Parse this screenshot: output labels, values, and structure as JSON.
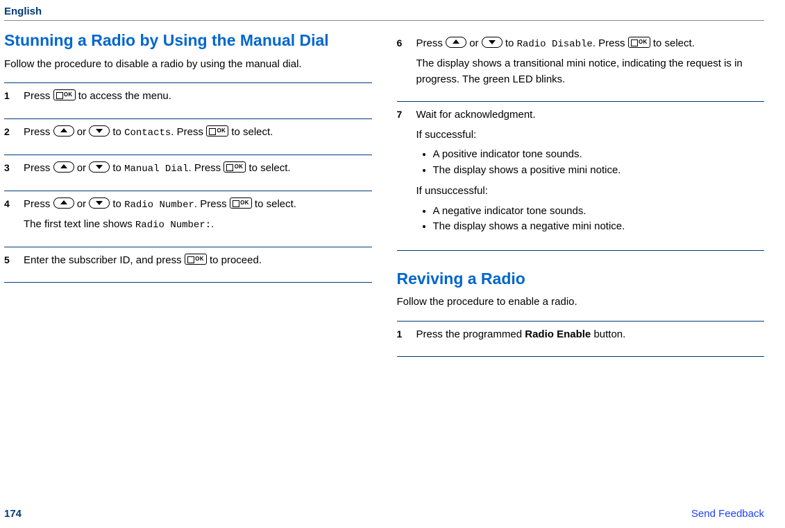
{
  "header": {
    "language": "English"
  },
  "left": {
    "title": "Stunning a Radio by Using the Manual Dial",
    "intro": "Follow the procedure to disable a radio by using the manual dial.",
    "steps": {
      "s1": {
        "n": "1",
        "a": "Press ",
        "b": " to access the menu."
      },
      "s2": {
        "n": "2",
        "a": "Press ",
        "b": " or ",
        "c": " to ",
        "menu": "Contacts",
        "d": ". Press ",
        "e": " to select."
      },
      "s3": {
        "n": "3",
        "a": "Press ",
        "b": " or ",
        "c": " to ",
        "menu": "Manual Dial",
        "d": ". Press ",
        "e": " to select."
      },
      "s4": {
        "n": "4",
        "a": "Press ",
        "b": " or ",
        "c": " to ",
        "menu": "Radio Number",
        "d": ". Press ",
        "e": " to select.",
        "line2a": "The first text line shows ",
        "line2menu": "Radio Number:",
        "line2b": "."
      },
      "s5": {
        "n": "5",
        "a": "Enter the subscriber ID, and press ",
        "b": " to proceed."
      }
    }
  },
  "right": {
    "s6": {
      "n": "6",
      "a": "Press ",
      "b": " or ",
      "c": " to ",
      "menu": "Radio Disable",
      "d": ". Press ",
      "e": " to select.",
      "p2": "The display shows a transitional mini notice, indicating the request is in progress. The green LED blinks."
    },
    "s7": {
      "n": "7",
      "p1": "Wait for acknowledgment.",
      "p2": "If successful:",
      "b1": "A positive indicator tone sounds.",
      "b2": "The display shows a positive mini notice.",
      "p3": "If unsuccessful:",
      "b3": "A negative indicator tone sounds.",
      "b4": "The display shows a negative mini notice."
    },
    "h2": "Reviving a Radio",
    "intro2": "Follow the procedure to enable a radio.",
    "s1b": {
      "n": "1",
      "a": "Press the programmed ",
      "bold": "Radio Enable",
      "b": " button."
    }
  },
  "footer": {
    "page": "174",
    "link": "Send Feedback"
  }
}
